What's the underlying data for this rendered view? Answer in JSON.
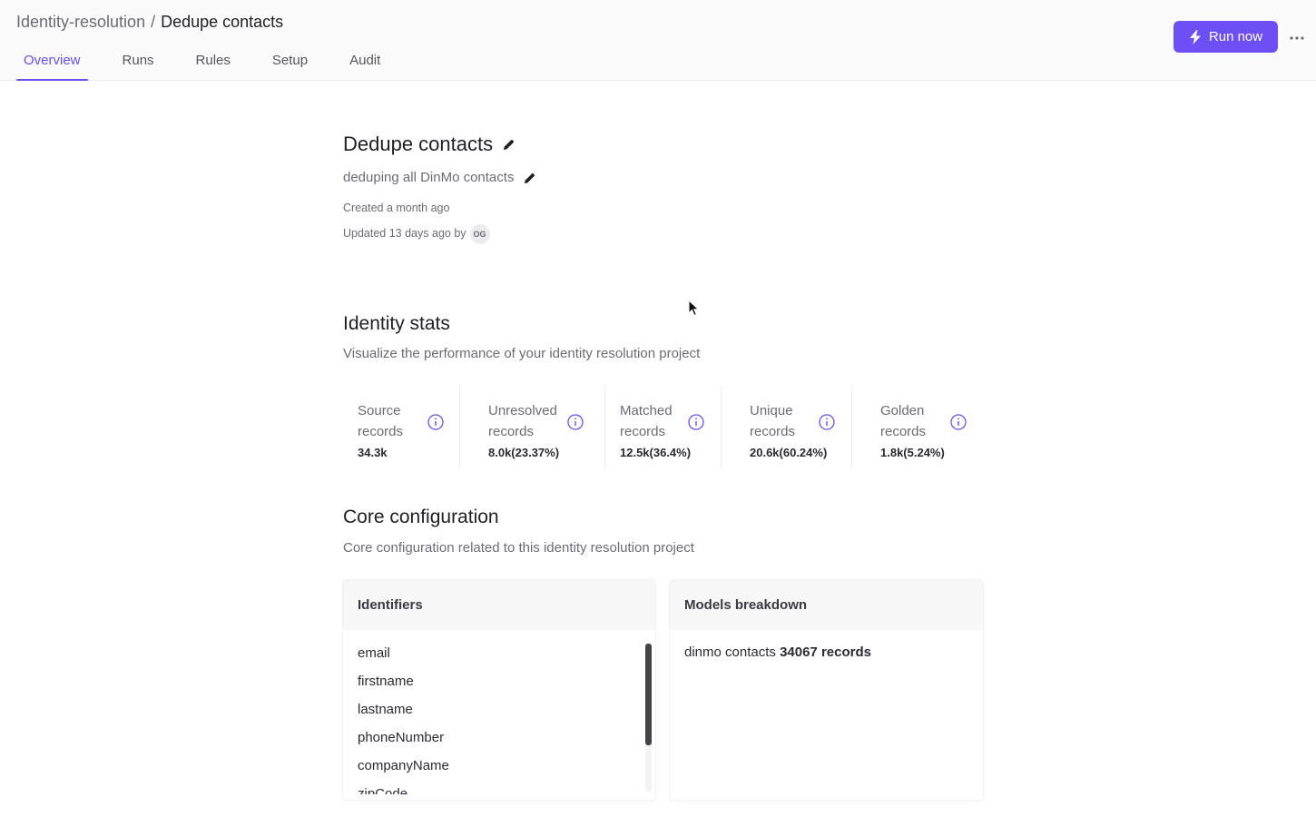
{
  "header": {
    "breadcrumb": {
      "parent": "Identity-resolution",
      "separator": "/",
      "current": "Dedupe contacts"
    },
    "tabs": [
      {
        "label": "Overview",
        "active": true
      },
      {
        "label": "Runs",
        "active": false
      },
      {
        "label": "Rules",
        "active": false
      },
      {
        "label": "Setup",
        "active": false
      },
      {
        "label": "Audit",
        "active": false
      }
    ],
    "run_button": {
      "label": "Run now",
      "icon": "lightning-icon"
    },
    "more_icon": "more-horizontal-icon"
  },
  "project": {
    "title": "Dedupe contacts",
    "description": "deduping all DinMo contacts",
    "created": "Created a month ago",
    "updated": "Updated 13 days ago by",
    "avatar_initials": "OG"
  },
  "identity_stats": {
    "title": "Identity stats",
    "description": "Visualize the performance of your identity resolution project",
    "cards": [
      {
        "label": "Source records",
        "value": "34.3k"
      },
      {
        "label": "Unresolved records",
        "value": "8.0k(23.37%)"
      },
      {
        "label": "Matched records",
        "value": "12.5k(36.4%)"
      },
      {
        "label": "Unique records",
        "value": "20.6k(60.24%)"
      },
      {
        "label": "Golden records",
        "value": "1.8k(5.24%)"
      }
    ]
  },
  "core_configuration": {
    "title": "Core configuration",
    "description": "Core configuration related to this identity resolution project",
    "identifiers": {
      "header": "Identifiers",
      "items": [
        "email",
        "firstname",
        "lastname",
        "phoneNumber",
        "companyName",
        "zipCode"
      ]
    },
    "models_breakdown": {
      "header": "Models breakdown",
      "model_name": "dinmo contacts",
      "record_count": "34067 records"
    }
  },
  "colors": {
    "accent": "#6a4ff0",
    "button": "#6e4ff6",
    "text_muted": "#6b6b74"
  }
}
